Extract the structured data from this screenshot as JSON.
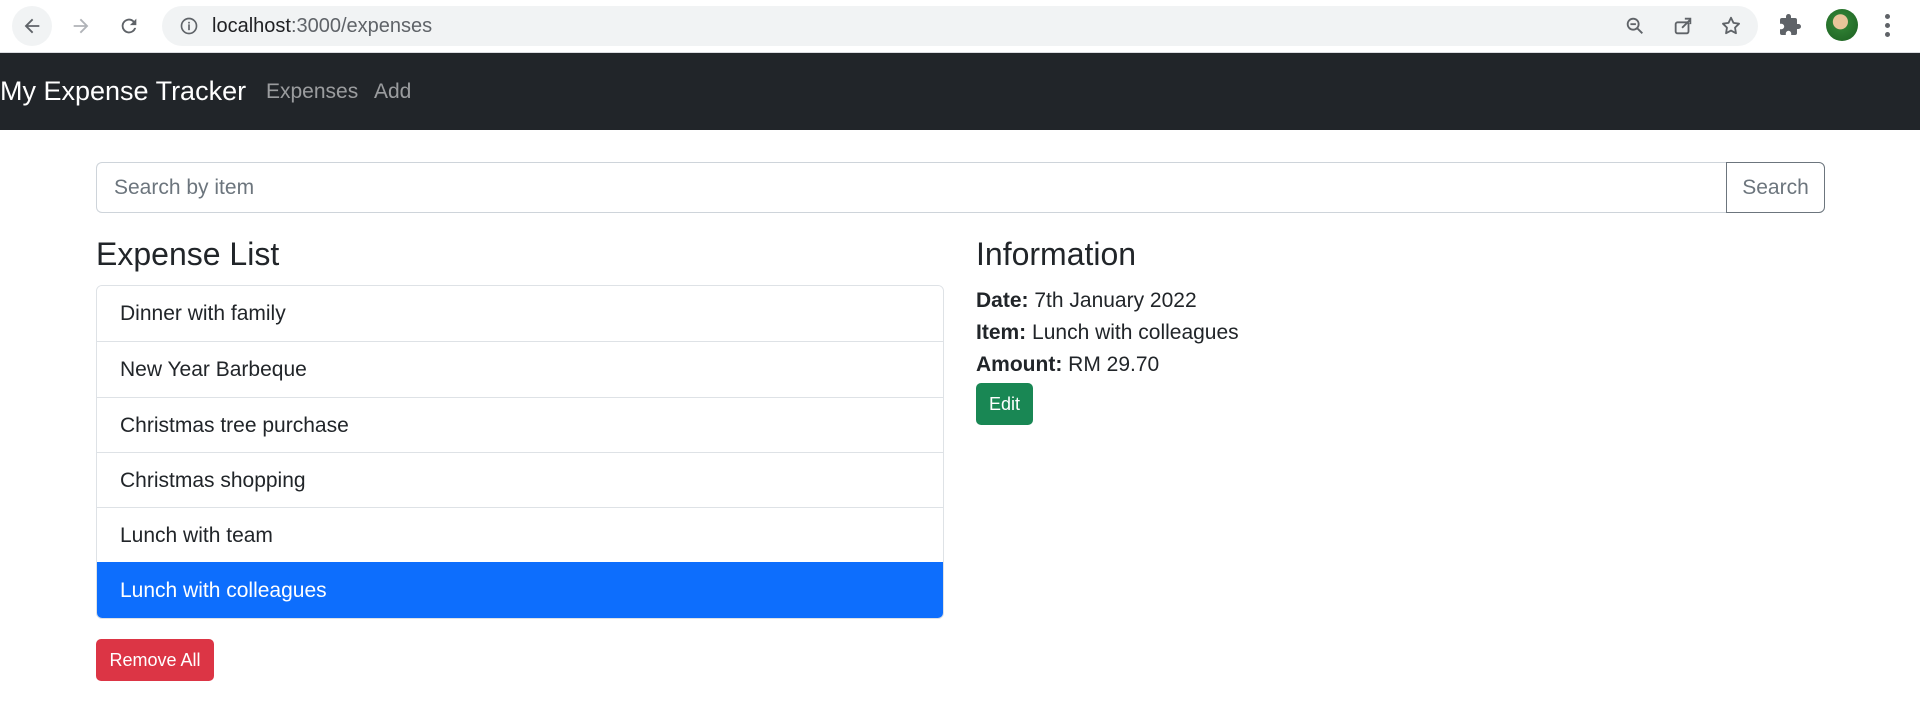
{
  "browser": {
    "url_host": "localhost",
    "url_path": ":3000/expenses",
    "icons": [
      "back-arrow-icon",
      "forward-arrow-icon",
      "reload-icon",
      "site-info-icon",
      "zoom-icon",
      "share-icon",
      "bookmark-star-icon",
      "extensions-icon",
      "profile-avatar",
      "more-menu-icon"
    ]
  },
  "navbar": {
    "brand": "My Expense Tracker",
    "links": [
      "Expenses",
      "Add"
    ]
  },
  "search": {
    "placeholder": "Search by item",
    "value": "",
    "button_label": "Search"
  },
  "expense_list": {
    "title": "Expense List",
    "items": [
      "Dinner with family",
      "New Year Barbeque",
      "Christmas tree purchase",
      "Christmas shopping",
      "Lunch with team",
      "Lunch with colleagues"
    ],
    "active_item": "Lunch with colleagues",
    "remove_all_label": "Remove All"
  },
  "information": {
    "title": "Information",
    "date_label": "Date:",
    "date_value": "7th January 2022",
    "item_label": "Item:",
    "item_value": "Lunch with colleagues",
    "amount_label": "Amount:",
    "amount_value": "RM 29.70",
    "edit_label": "Edit"
  },
  "colors": {
    "navbar_bg": "#212529",
    "active_item": "#0d6efd",
    "danger": "#dc3545",
    "success": "#198754"
  }
}
